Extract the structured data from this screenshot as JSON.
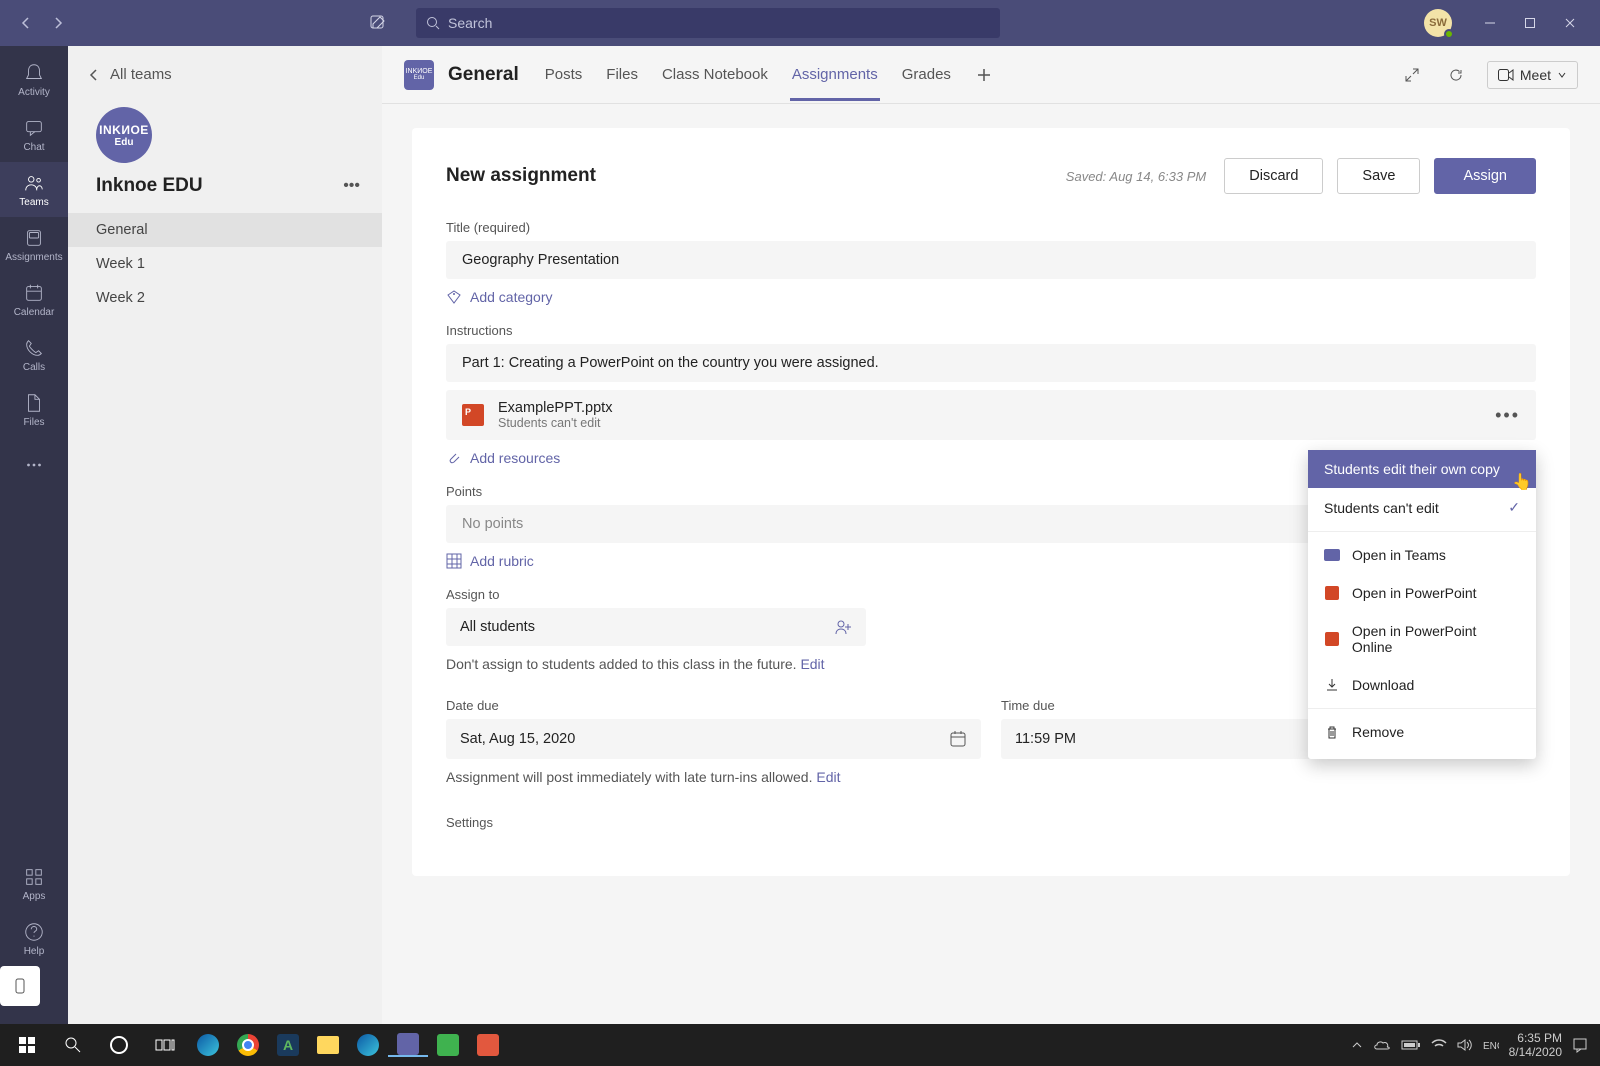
{
  "titlebar": {
    "search_placeholder": "Search",
    "avatar_initials": "SW"
  },
  "rail": {
    "items": [
      {
        "label": "Activity"
      },
      {
        "label": "Chat"
      },
      {
        "label": "Teams"
      },
      {
        "label": "Assignments"
      },
      {
        "label": "Calendar"
      },
      {
        "label": "Calls"
      },
      {
        "label": "Files"
      }
    ],
    "apps": "Apps",
    "help": "Help"
  },
  "sidepanel": {
    "all_teams": "All teams",
    "team_avatar_line1": "INKИOE",
    "team_avatar_line2": "Edu",
    "team_name": "Inknoe EDU",
    "channels": [
      "General",
      "Week 1",
      "Week 2"
    ]
  },
  "tabs": {
    "channel_name": "General",
    "items": [
      "Posts",
      "Files",
      "Class Notebook",
      "Assignments",
      "Grades"
    ],
    "meet": "Meet"
  },
  "form": {
    "heading": "New assignment",
    "saved": "Saved: Aug 14, 6:33 PM",
    "discard": "Discard",
    "save": "Save",
    "assign": "Assign",
    "title_label": "Title (required)",
    "title_value": "Geography Presentation",
    "add_category": "Add category",
    "instructions_label": "Instructions",
    "instructions_value": "Part 1: Creating a PowerPoint on the country you were assigned.",
    "attachment_name": "ExamplePPT.pptx",
    "attachment_sub": "Students can't edit",
    "add_resources": "Add resources",
    "points_label": "Points",
    "points_placeholder": "No points",
    "add_rubric": "Add rubric",
    "assign_to_label": "Assign to",
    "assign_to_value": "All students",
    "assign_future": "Don't assign to students added to this class in the future. ",
    "edit": "Edit",
    "date_due_label": "Date due",
    "date_due_value": "Sat, Aug 15, 2020",
    "time_due_label": "Time due",
    "time_due_value": "11:59 PM",
    "post_note": "Assignment will post immediately with late turn-ins allowed. ",
    "settings_label": "Settings"
  },
  "dropdown": {
    "edit_own": "Students edit their own copy",
    "cant_edit": "Students can't edit",
    "open_teams": "Open in Teams",
    "open_ppt": "Open in PowerPoint",
    "open_ppt_online": "Open in PowerPoint Online",
    "download": "Download",
    "remove": "Remove"
  },
  "taskbar": {
    "time": "6:35 PM",
    "date": "8/14/2020"
  }
}
